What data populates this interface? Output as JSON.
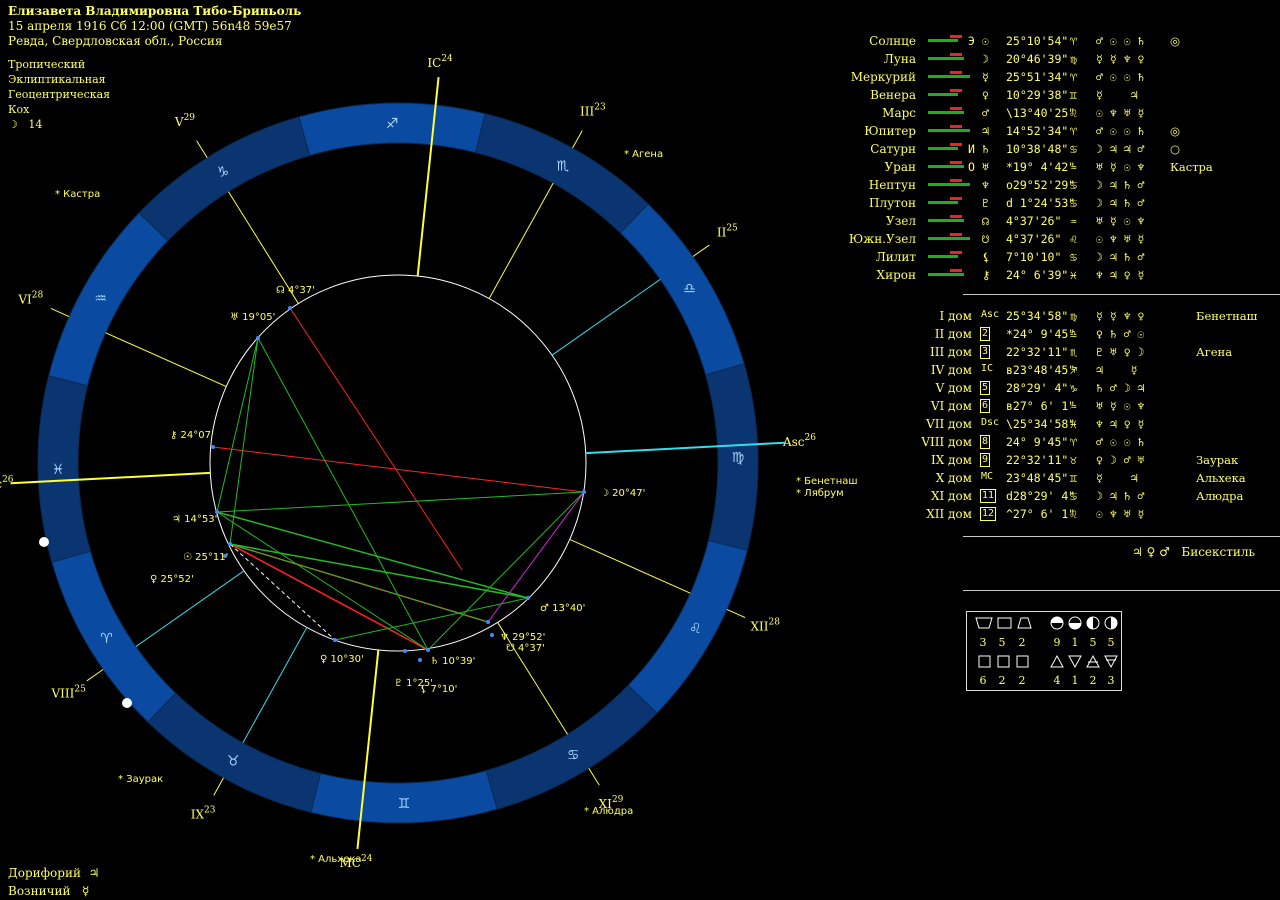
{
  "header": {
    "name": "Елизавета Владимировна Тибо-Бриньоль",
    "datetime": "15 апреля 1916  Сб  12:00 (GMT) 56n48  59e57",
    "place": "Ревда, Свердловская обл., Россия"
  },
  "settings": [
    "Тропический",
    "Эклиптикальная",
    "Геоцентрическая",
    "Кох"
  ],
  "moon_day": {
    "glyph": "☽",
    "value": "14"
  },
  "footer": [
    {
      "label": "Дорифорий",
      "glyph": "♃"
    },
    {
      "label": "Возничий",
      "glyph": "☿"
    }
  ],
  "zodiac_glyphs": [
    "♈",
    "♉",
    "♊",
    "♋",
    "♌",
    "♍",
    "♎",
    "♏",
    "♐",
    "♑",
    "♒",
    "♓"
  ],
  "houses": [
    {
      "label": "Asc",
      "deg": "26"
    },
    {
      "label": "II",
      "deg": "25"
    },
    {
      "label": "III",
      "deg": "23"
    },
    {
      "label": "IC",
      "deg": "24"
    },
    {
      "label": "V",
      "deg": "29"
    },
    {
      "label": "VI",
      "deg": "28"
    },
    {
      "label": "Dsc",
      "deg": "26"
    },
    {
      "label": "VIII",
      "deg": "25"
    },
    {
      "label": "IX",
      "deg": "23"
    },
    {
      "label": "MC",
      "deg": "24"
    },
    {
      "label": "XI",
      "deg": "29"
    },
    {
      "label": "XII",
      "deg": "28"
    }
  ],
  "stars_on_chart": [
    {
      "label": "Агена"
    },
    {
      "label": "Кастра"
    },
    {
      "label": "Бенетнаш"
    },
    {
      "label": "Лябрум"
    },
    {
      "label": "Заурак"
    },
    {
      "label": "Альхека"
    },
    {
      "label": "Алюдра"
    }
  ],
  "planet_points": [
    {
      "glyph": "☽",
      "deg": "20°47'"
    },
    {
      "glyph": "♂",
      "deg": "13°40'"
    },
    {
      "glyph": "♆",
      "deg": "29°52'"
    },
    {
      "glyph": "☋",
      "deg": "4°37'"
    },
    {
      "glyph": "♄",
      "deg": "10°39'"
    },
    {
      "glyph": "⚸",
      "deg": "7°10'"
    },
    {
      "glyph": "♇",
      "deg": "1°25'"
    },
    {
      "glyph": "♀",
      "deg": "10°30'"
    },
    {
      "glyph": "♀",
      "deg": "25°52'"
    },
    {
      "glyph": "☉",
      "deg": "25°11'"
    },
    {
      "glyph": "♃",
      "deg": "14°53'"
    },
    {
      "glyph": "⚷",
      "deg": "24°07'"
    },
    {
      "glyph": "♅",
      "deg": "19°05'"
    },
    {
      "glyph": "☊",
      "deg": "4°37'"
    }
  ],
  "planets": [
    {
      "name": "Солнце",
      "g": "☉",
      "mark": "Э",
      "pos": "25°10'54\"",
      "sign": "♈",
      "rul": "♂ ☉ ☉ ♄",
      "extra": "◎"
    },
    {
      "name": "Луна",
      "g": "☽",
      "mark": "",
      "pos": "20°46'39\"",
      "sign": "♍",
      "rul": "☿ ☿ ♆ ♀",
      "extra": ""
    },
    {
      "name": "Меркурий",
      "g": "☿",
      "mark": "",
      "pos": "25°51'34\"",
      "sign": "♈",
      "rul": "♂ ☉ ☉ ♄",
      "extra": ""
    },
    {
      "name": "Венера",
      "g": "♀",
      "mark": "",
      "pos": "10°29'38\"",
      "sign": "♊",
      "rul": "☿    ♃",
      "extra": ""
    },
    {
      "name": "Марс",
      "g": "♂",
      "mark": "",
      "pos": "\\13°40'25\"",
      "sign": "♌",
      "rul": "☉ ♆ ♅ ☿",
      "extra": ""
    },
    {
      "name": "Юпитер",
      "g": "♃",
      "mark": "",
      "pos": "14°52'34\"",
      "sign": "♈",
      "rul": "♂ ☉ ☉ ♄",
      "extra": "◎"
    },
    {
      "name": "Сатурн",
      "g": "♄",
      "mark": "И",
      "pos": "10°38'48\"",
      "sign": "♋",
      "rul": "☽ ♃ ♃ ♂",
      "extra": "○"
    },
    {
      "name": "Уран",
      "g": "♅",
      "mark": "О",
      "pos": "*19° 4'42\"",
      "sign": "♒",
      "rul": "♅ ☿ ☉ ♆",
      "extra": "Кастра"
    },
    {
      "name": "Нептун",
      "g": "♆",
      "mark": "",
      "pos": "о29°52'29\"",
      "sign": "♋",
      "rul": "☽ ♃ ♄ ♂",
      "extra": ""
    },
    {
      "name": "Плутон",
      "g": "♇",
      "mark": "",
      "pos": "d 1°24'53\"",
      "sign": "♋",
      "rul": "☽ ♃ ♄ ♂",
      "extra": ""
    },
    {
      "name": "Узел",
      "g": "☊",
      "mark": "",
      "pos": "4°37'26\"",
      "sign": "♒",
      "rul": "♅ ☿ ☉ ♆",
      "extra": ""
    },
    {
      "name": "Южн.Узел",
      "g": "☋",
      "mark": "",
      "pos": "4°37'26\"",
      "sign": "♌",
      "rul": "☉ ♆ ♅ ☿",
      "extra": ""
    },
    {
      "name": "Лилит",
      "g": "⚸",
      "mark": "",
      "pos": "7°10'10\"",
      "sign": "♋",
      "rul": "☽ ♃ ♄ ♂",
      "extra": ""
    },
    {
      "name": "Хирон",
      "g": "⚷",
      "mark": "",
      "pos": "24° 6'39\"",
      "sign": "♓",
      "rul": "♆ ♃ ♀ ☿",
      "extra": ""
    }
  ],
  "house_table": [
    {
      "name": "I дом",
      "g": "Asc",
      "pos": "25°34'58\"",
      "sign": "♍",
      "rul": "☿ ☿ ♆ ♀",
      "extra": "Бенетнаш"
    },
    {
      "name": "II дом",
      "g": "2",
      "pos": "*24° 9'45\"",
      "sign": "♎",
      "rul": "♀ ♄ ♂ ☉",
      "extra": ""
    },
    {
      "name": "III дом",
      "g": "3",
      "pos": "22°32'11\"",
      "sign": "♏",
      "rul": "♇ ♅ ♀ ☽",
      "extra": "Агена"
    },
    {
      "name": "IV дом",
      "g": "IC",
      "pos": "в23°48'45\"",
      "sign": "♐",
      "rul": "♃    ☿",
      "extra": ""
    },
    {
      "name": "V дом",
      "g": "5",
      "pos": "28°29' 4\"",
      "sign": "♑",
      "rul": "♄ ♂ ☽ ♃",
      "extra": ""
    },
    {
      "name": "VI дом",
      "g": "6",
      "pos": "в27° 6' 1\"",
      "sign": "♒",
      "rul": "♅ ☿ ☉ ♆",
      "extra": ""
    },
    {
      "name": "VII дом",
      "g": "Dsc",
      "pos": "\\25°34'58\"",
      "sign": "♓",
      "rul": "♆ ♃ ♀ ☿",
      "extra": ""
    },
    {
      "name": "VIII дом",
      "g": "8",
      "pos": "24° 9'45\"",
      "sign": "♈",
      "rul": "♂ ☉ ☉ ♄",
      "extra": ""
    },
    {
      "name": "IX дом",
      "g": "9",
      "pos": "22°32'11\"",
      "sign": "♉",
      "rul": "♀ ☽ ♂ ♅",
      "extra": "Заурак"
    },
    {
      "name": "X дом",
      "g": "MC",
      "pos": "23°48'45\"",
      "sign": "♊",
      "rul": "☿    ♃",
      "extra": "Альхека"
    },
    {
      "name": "XI дом",
      "g": "11",
      "pos": "d28°29' 4\"",
      "sign": "♋",
      "rul": "☽ ♃ ♄ ♂",
      "extra": "Алюдра"
    },
    {
      "name": "XII дом",
      "g": "12",
      "pos": "^27° 6' 1\"",
      "sign": "♌",
      "rul": "☉ ♆ ♅ ☿",
      "extra": ""
    }
  ],
  "bisextile": {
    "glyphs": "♃ ♀ ♂",
    "label": "Бисекстиль"
  },
  "elements": {
    "row1": [
      "3",
      "5",
      "2",
      "9",
      "1",
      "5",
      "5"
    ],
    "row2": [
      "6",
      "2",
      "2",
      "4",
      "1",
      "2",
      "3"
    ]
  },
  "colors": {
    "bg": "#000000",
    "text": "#ffff66",
    "ring": "#0a4aa0",
    "ring_dark": "#0a3570",
    "cusp": "#ffff33",
    "cyan": "#33ddee"
  }
}
